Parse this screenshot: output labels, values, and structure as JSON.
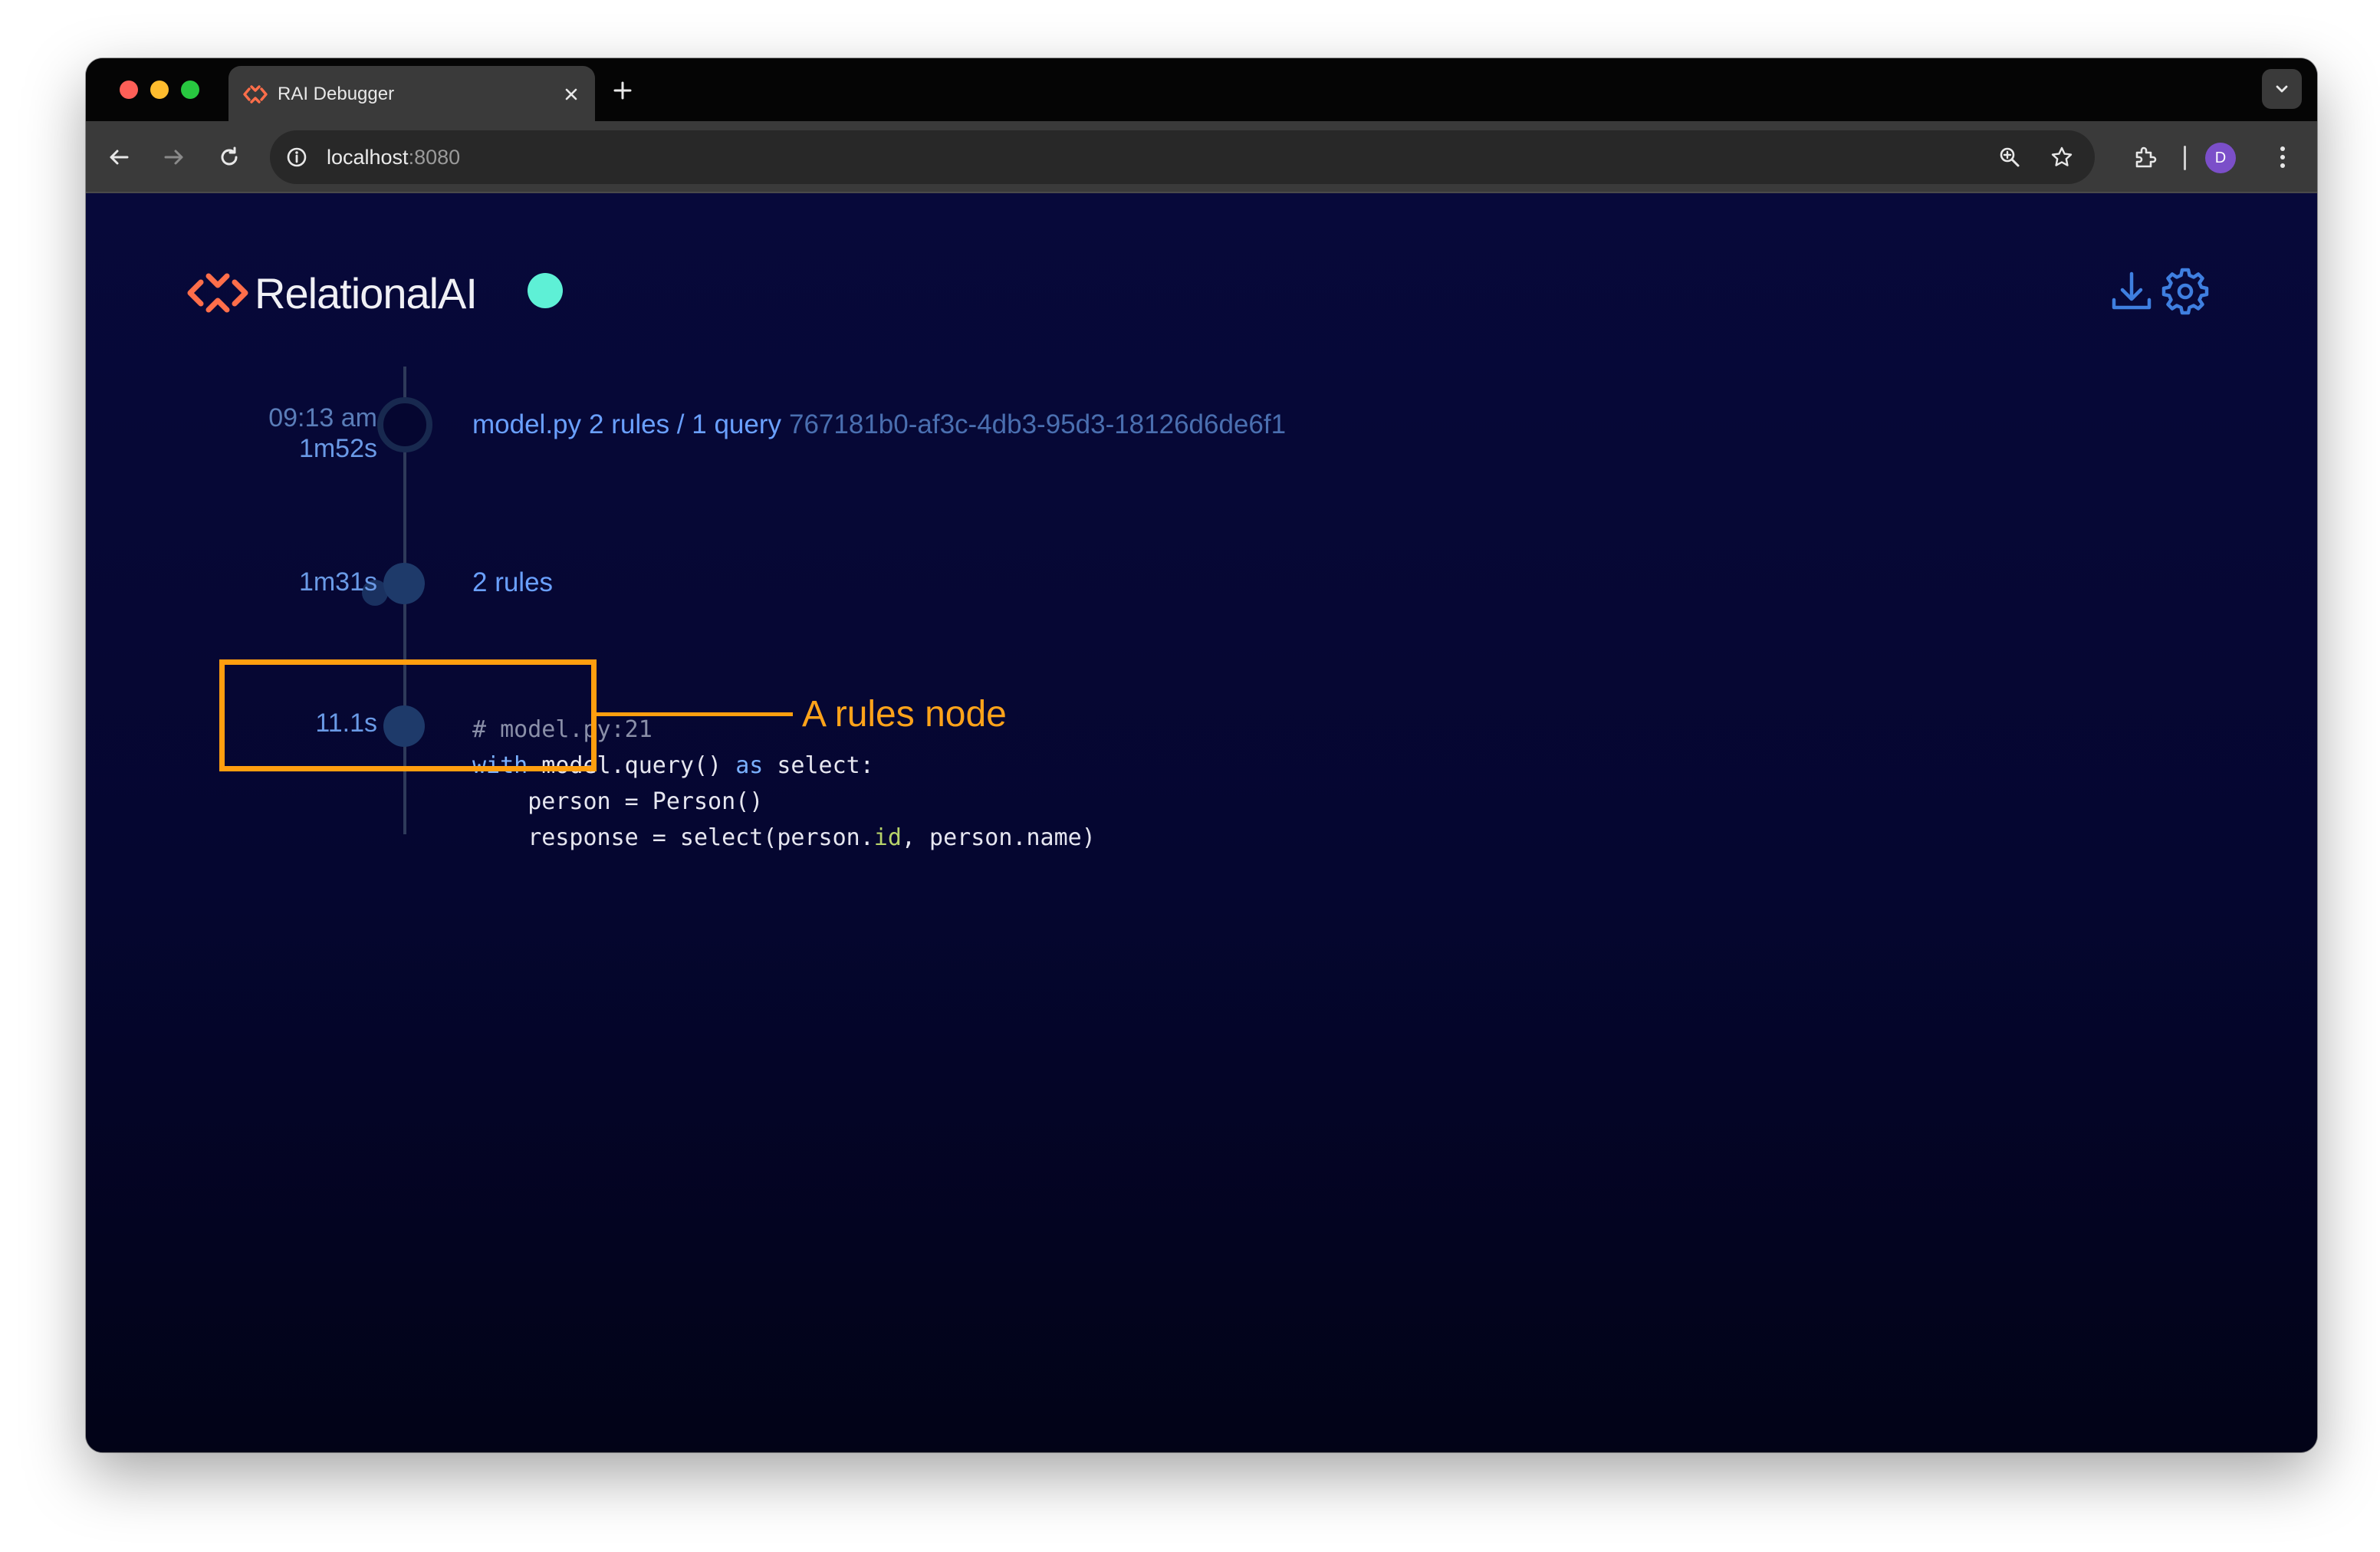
{
  "browser": {
    "tab_title": "RAI Debugger",
    "url_host": "localhost",
    "url_port": ":8080",
    "profile_initial": "D"
  },
  "app": {
    "brand": "RelationalAI",
    "status_color": "#5ef0d6"
  },
  "timeline": {
    "run": {
      "start_time": "09:13 am",
      "duration": "1m52s",
      "file": "model.py",
      "counts": "2 rules / 1 query",
      "id": "767181b0-af3c-4db3-95d3-18126d6de6f1"
    },
    "rules_node": {
      "duration": "1m31s",
      "label": "2 rules"
    },
    "query_node": {
      "duration": "11.1s",
      "code": {
        "comment": "# model.py:21",
        "line2_kw1": "with",
        "line2_mid": " model.query() ",
        "line2_kw2": "as",
        "line2_end": " select:",
        "line3": "    person = Person()",
        "line4_a": "    response = select(person.",
        "line4_attr": "id",
        "line4_b": ", person.name)"
      }
    }
  },
  "annotation": {
    "label": "A rules node",
    "color": "#ff9e0f"
  }
}
